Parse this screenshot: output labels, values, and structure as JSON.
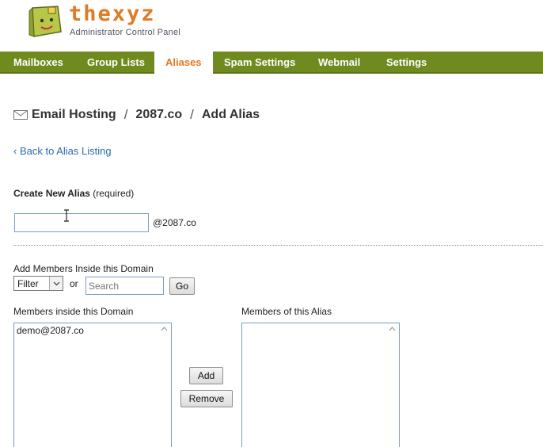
{
  "header": {
    "logo_name": "thexyz",
    "logo_subtitle": "Administrator Control Panel",
    "brand_color": "#e07a24"
  },
  "nav": {
    "items": [
      {
        "label": "Mailboxes",
        "active": false
      },
      {
        "label": "Group Lists",
        "active": false
      },
      {
        "label": "Aliases",
        "active": true
      },
      {
        "label": "Spam Settings",
        "active": false
      },
      {
        "label": "Webmail",
        "active": false
      },
      {
        "label": "Settings",
        "active": false
      }
    ],
    "bar_color": "#6f8a1e",
    "active_color": "#e8761f"
  },
  "breadcrumb": {
    "icon": "envelope-icon",
    "crumbs": [
      "Email Hosting",
      "2087.co",
      "Add Alias"
    ],
    "separator": "/"
  },
  "back_link": "‹ Back to Alias Listing",
  "create": {
    "label": "Create New Alias",
    "required_note": "(required)",
    "input_value": "",
    "domain_suffix": "@2087.co"
  },
  "add_members": {
    "label": "Add Members Inside this Domain",
    "filter_selected": "Filter",
    "or_text": "or",
    "search_placeholder": "Search",
    "go_label": "Go"
  },
  "lists": {
    "inside_label": "Members inside this Domain",
    "inside_items": [
      "demo@2087.co"
    ],
    "alias_label": "Members of this Alias",
    "alias_items": []
  },
  "actions": {
    "add_label": "Add",
    "remove_label": "Remove"
  }
}
